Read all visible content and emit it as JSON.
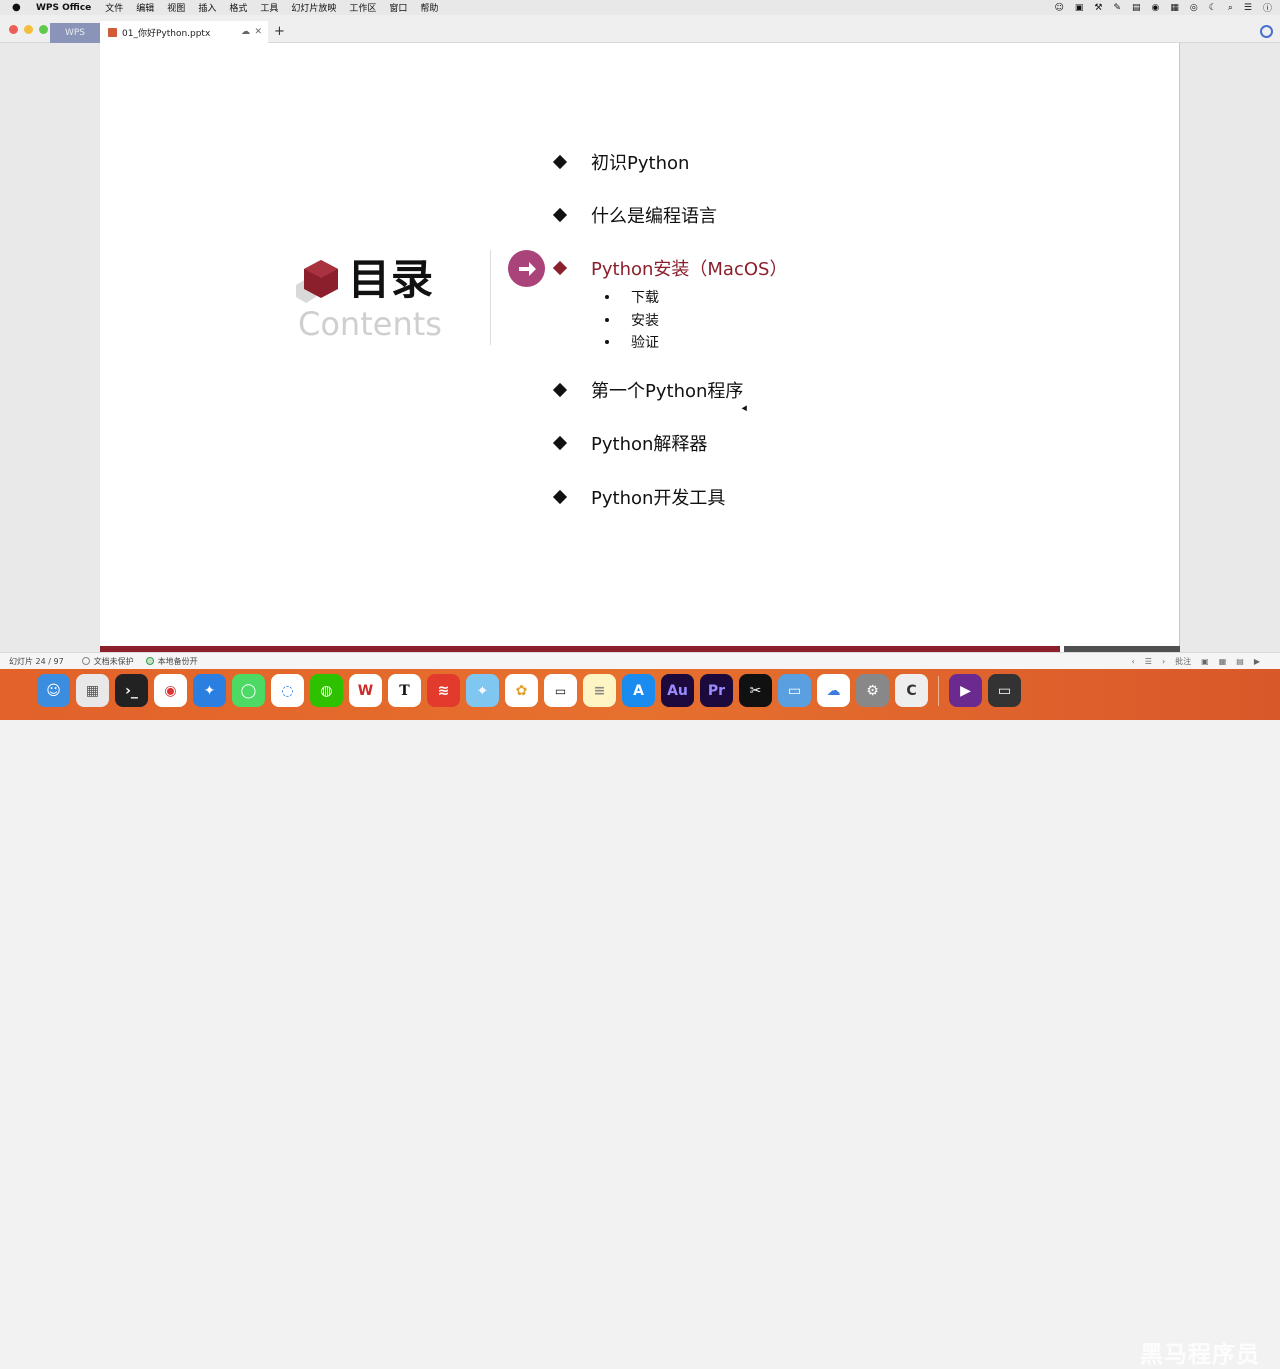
{
  "menubar": {
    "app_name": "WPS Office",
    "items": [
      "文件",
      "编辑",
      "视图",
      "插入",
      "格式",
      "工具",
      "幻灯片放映",
      "工作区",
      "窗口",
      "帮助"
    ]
  },
  "tabs": {
    "wps_label": "WPS",
    "document_title": "01_你好Python.pptx"
  },
  "slide": {
    "title": "目录",
    "subtitle": "Contents",
    "items": [
      {
        "label": "初识Python"
      },
      {
        "label": "什么是编程语言"
      },
      {
        "label": "Python安装（MacOS）",
        "active": true
      },
      {
        "label": "第一个Python程序"
      },
      {
        "label": "Python解释器"
      },
      {
        "label": "Python开发工具"
      }
    ],
    "sub_items": [
      "下载",
      "安装",
      "验证"
    ]
  },
  "statusbar": {
    "slide_counter": "幻灯片 24 / 97",
    "protection": "文档未保护",
    "backup": "本地备份开",
    "notes": "批注"
  },
  "dock": {
    "watermark": "黑马程序员"
  },
  "colors": {
    "accent": "#8b1f2b",
    "arrow_circle": "#a9437a"
  }
}
